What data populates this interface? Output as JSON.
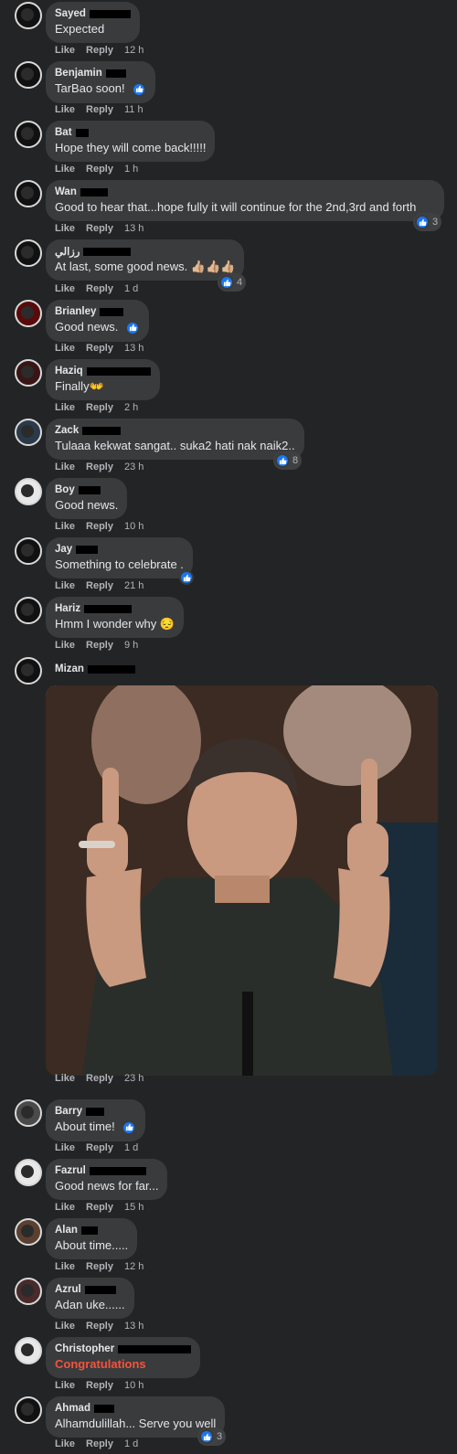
{
  "comments": [
    {
      "author": "Sayed",
      "text": "Expected",
      "like": "Like",
      "reply": "Reply",
      "time": "12 h"
    },
    {
      "author": "Benjamin",
      "text": "TarBao soon!",
      "like": "Like",
      "reply": "Reply",
      "time": "11 h"
    },
    {
      "author": "Bat",
      "text": "Hope they will come back!!!!!",
      "like": "Like",
      "reply": "Reply",
      "time": "1 h"
    },
    {
      "author": "Wan",
      "text": "Good to hear that...hope fully it will continue for the 2nd,3rd and forth",
      "like": "Like",
      "reply": "Reply",
      "time": "13 h",
      "reactions": "3"
    },
    {
      "author": "رزالي",
      "text": "At last, some good news. 👍🏼👍🏼👍🏼",
      "like": "Like",
      "reply": "Reply",
      "time": "1 d",
      "reactions": "4"
    },
    {
      "author": "Brianley",
      "text": "Good news.",
      "like": "Like",
      "reply": "Reply",
      "time": "13 h"
    },
    {
      "author": "Haziq",
      "text": "Finally👐",
      "like": "Like",
      "reply": "Reply",
      "time": "2 h"
    },
    {
      "author": "Zack",
      "text": "Tulaaa kekwat sangat.. suka2 hati nak naik2..",
      "like": "Like",
      "reply": "Reply",
      "time": "23 h",
      "reactions": "8"
    },
    {
      "author": "Boy",
      "text": "Good news.",
      "like": "Like",
      "reply": "Reply",
      "time": "10 h"
    },
    {
      "author": "Jay",
      "text": "Something to celebrate .",
      "like": "Like",
      "reply": "Reply",
      "time": "21 h"
    },
    {
      "author": "Hariz",
      "text": "Hmm I wonder why 😔",
      "like": "Like",
      "reply": "Reply",
      "time": "9 h"
    },
    {
      "author": "Mizan",
      "text": "",
      "like": "Like",
      "reply": "Reply",
      "time": "23 h"
    },
    {
      "author": "Barry",
      "text": "About time!",
      "like": "Like",
      "reply": "Reply",
      "time": "1 d"
    },
    {
      "author": "Fazrul",
      "text": "Good news for far...",
      "like": "Like",
      "reply": "Reply",
      "time": "15 h"
    },
    {
      "author": "Alan",
      "text": "About time.....",
      "like": "Like",
      "reply": "Reply",
      "time": "12 h"
    },
    {
      "author": "Azrul",
      "text": "Adan uke......",
      "like": "Like",
      "reply": "Reply",
      "time": "13 h"
    },
    {
      "author": "Christopher",
      "text": "Congratulations",
      "like": "Like",
      "reply": "Reply",
      "time": "10 h"
    },
    {
      "author": "Ahmad",
      "text": "Alhamdulillah... Serve you well",
      "like": "Like",
      "reply": "Reply",
      "time": "1 d",
      "reactions": "3"
    }
  ],
  "colors": {
    "background": "#232425",
    "bubble": "#3a3b3c",
    "like_blue": "#1877f2",
    "congrats": "#f5533d"
  },
  "icons": {
    "reaction": "like-thumb-icon"
  }
}
